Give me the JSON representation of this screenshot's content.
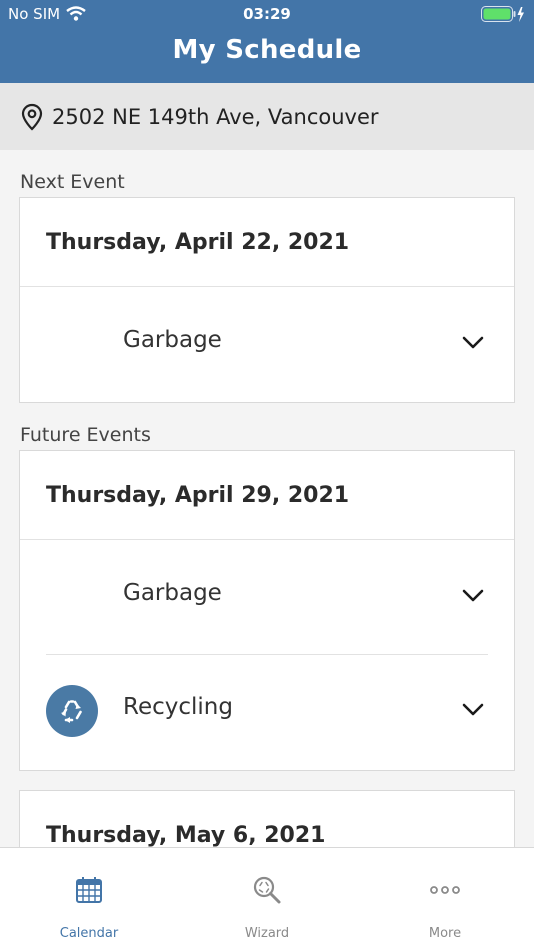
{
  "status_bar": {
    "carrier": "No SIM",
    "time": "03:29"
  },
  "header": {
    "title": "My Schedule"
  },
  "address": {
    "text": "2502 NE 149th Ave, Vancouver"
  },
  "next_event": {
    "section_label": "Next Event",
    "date": "Thursday, April 22, 2021",
    "items": [
      {
        "label": "Garbage",
        "icon": "none"
      }
    ]
  },
  "future_events": {
    "section_label": "Future Events",
    "days": [
      {
        "date": "Thursday, April 29, 2021",
        "items": [
          {
            "label": "Garbage",
            "icon": "none"
          },
          {
            "label": "Recycling",
            "icon": "recycle-icon"
          }
        ]
      },
      {
        "date": "Thursday, May 6, 2021",
        "items": []
      }
    ]
  },
  "tab_bar": {
    "tabs": [
      {
        "label": "Calendar",
        "icon": "calendar-icon",
        "active": true
      },
      {
        "label": "Wizard",
        "icon": "wizard-search-icon",
        "active": false
      },
      {
        "label": "More",
        "icon": "more-dots-icon",
        "active": false
      }
    ]
  },
  "colors": {
    "header": "#4375a8",
    "accent": "#4375a8",
    "recycle_badge": "#4a7aa5",
    "background": "#f4f4f4"
  }
}
